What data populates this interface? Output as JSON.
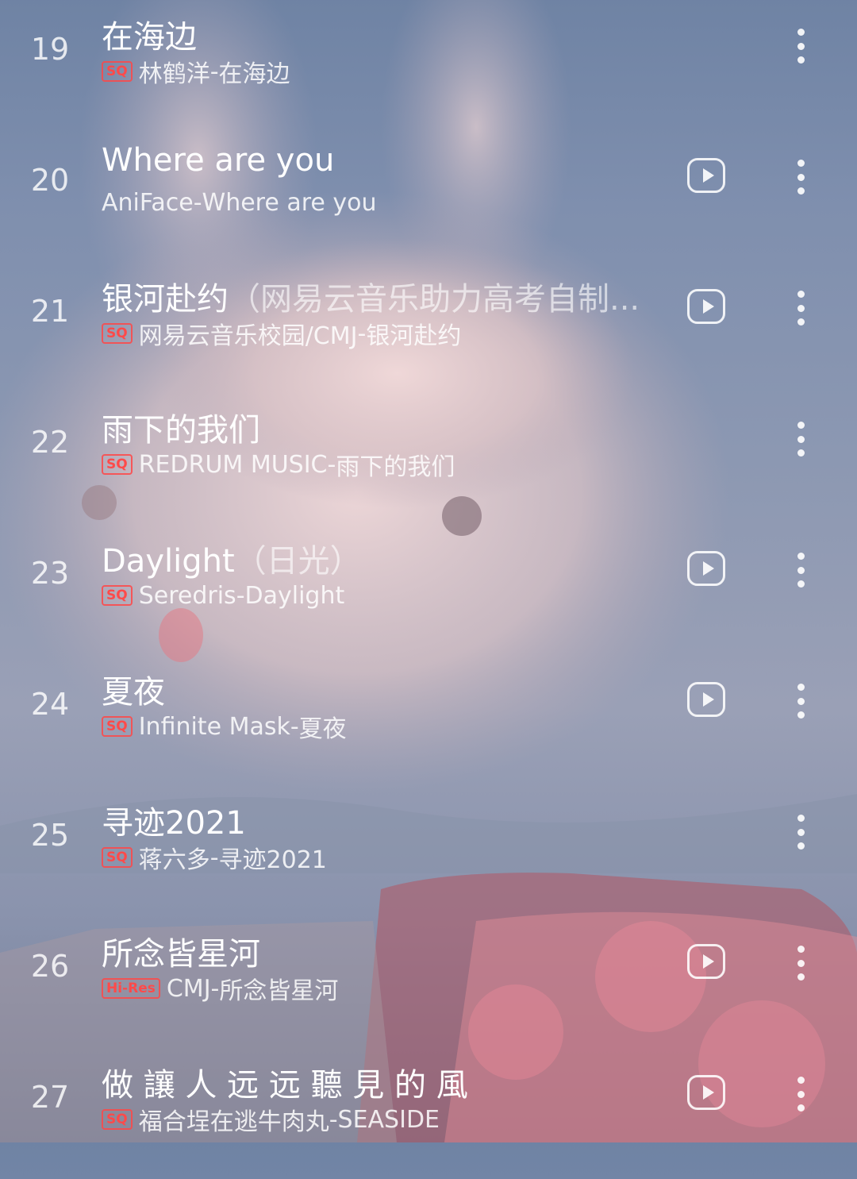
{
  "songs": [
    {
      "index": "19",
      "title": "在海边",
      "title_extra": "",
      "badge": "SQ",
      "artist": "林鹤洋",
      "album": "在海边",
      "play_icon": false
    },
    {
      "index": "20",
      "title": "Where are you",
      "title_extra": "",
      "badge": "",
      "artist": "AniFace",
      "album": "Where are you",
      "play_icon": true
    },
    {
      "index": "21",
      "title": "银河赴约",
      "title_extra": "（网易云音乐助力高考自制...",
      "badge": "SQ",
      "artist": "网易云音乐校园/CMJ",
      "album": "银河赴约",
      "play_icon": true
    },
    {
      "index": "22",
      "title": "雨下的我们",
      "title_extra": "",
      "badge": "SQ",
      "artist": "REDRUM MUSIC",
      "album": "雨下的我们",
      "play_icon": false
    },
    {
      "index": "23",
      "title": "Daylight",
      "title_extra": "（日光）",
      "badge": "SQ",
      "artist": "Seredris",
      "album": "Daylight",
      "play_icon": true
    },
    {
      "index": "24",
      "title": "夏夜",
      "title_extra": "",
      "badge": "SQ",
      "artist": "Infinite Mask",
      "album": "夏夜",
      "play_icon": true
    },
    {
      "index": "25",
      "title": "寻迹2021",
      "title_extra": "",
      "badge": "SQ",
      "artist": "蒋六多",
      "album": "寻迹2021",
      "play_icon": false
    },
    {
      "index": "26",
      "title": "所念皆星河",
      "title_extra": "",
      "badge": "Hi-Res",
      "artist": "CMJ",
      "album": "所念皆星河",
      "play_icon": true
    },
    {
      "index": "27",
      "title": "做 讓 人 远 远 聽 見 的 風",
      "title_extra": "",
      "badge": "SQ",
      "artist": "福合埕在逃牛肉丸",
      "album": "SEASIDE",
      "play_icon": true
    }
  ],
  "separator": " - ",
  "icons": {
    "play": "play-video-icon",
    "more": "more-vertical-icon"
  },
  "colors": {
    "badge": "#ff4a4a",
    "text": "#ffffff"
  }
}
